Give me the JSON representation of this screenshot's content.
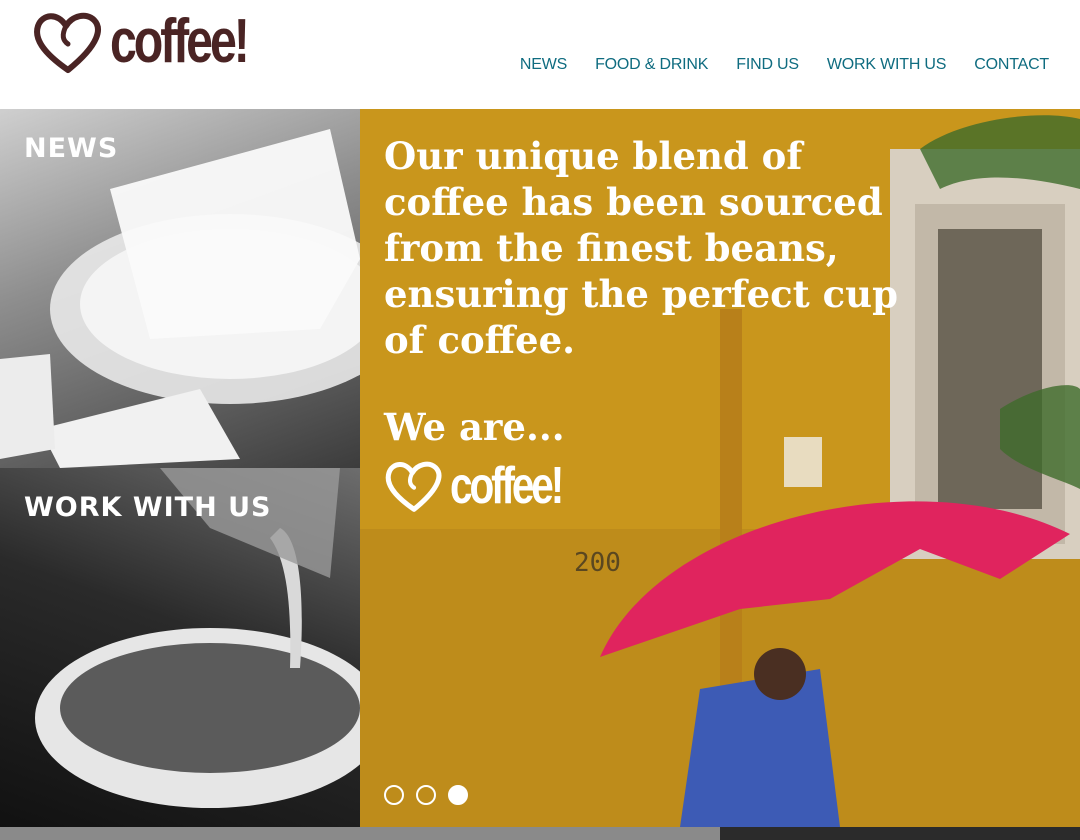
{
  "brand": {
    "logo_text": "coffee!",
    "heart_icon": "heart-logo-icon",
    "color": "#4a2424"
  },
  "nav": {
    "color": "#0f6c80",
    "items": [
      "NEWS",
      "FOOD & DRINK",
      "FIND US",
      "WORK WITH US",
      "CONTACT"
    ]
  },
  "tiles": {
    "news_label": "NEWS",
    "work_label": "WORK WITH US"
  },
  "hero": {
    "text": "Our unique blend of coffee has been sourced from the finest beans, ensuring the perfect cup of coffee.",
    "tagline": "We are...",
    "logo_text": "coffee!",
    "background": "#cc9a1c",
    "photo_text": "200",
    "slides": {
      "count": 3,
      "active_index": 2
    }
  }
}
